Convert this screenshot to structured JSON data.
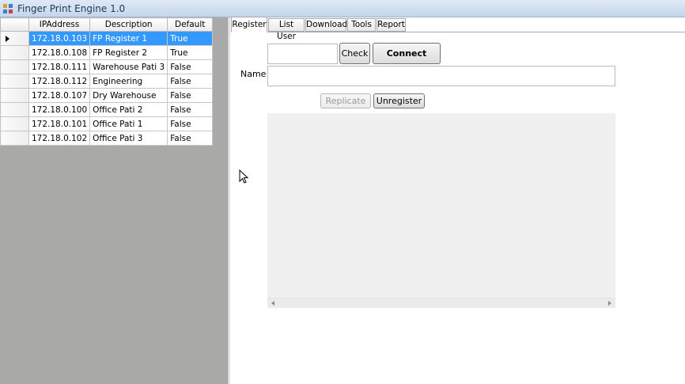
{
  "window": {
    "title": "Finger Print Engine 1.0"
  },
  "grid": {
    "columns": [
      "IPAddress",
      "Description",
      "Default"
    ],
    "selected_row": 0,
    "rows": [
      {
        "ip": "172.18.0.103",
        "description": "FP Register 1",
        "default": "True"
      },
      {
        "ip": "172.18.0.108",
        "description": "FP Register 2",
        "default": "True"
      },
      {
        "ip": "172.18.0.111",
        "description": "Warehouse Pati 3",
        "default": "False"
      },
      {
        "ip": "172.18.0.112",
        "description": "Engineering",
        "default": "False"
      },
      {
        "ip": "172.18.0.107",
        "description": "Dry Warehouse",
        "default": "False"
      },
      {
        "ip": "172.18.0.100",
        "description": "Office Pati 2",
        "default": "False"
      },
      {
        "ip": "172.18.0.101",
        "description": "Office Pati 1",
        "default": "False"
      },
      {
        "ip": "172.18.0.102",
        "description": "Office Pati 3",
        "default": "False"
      }
    ]
  },
  "tabs": [
    {
      "label": "Register",
      "active": true
    },
    {
      "label": "List User",
      "active": false
    },
    {
      "label": "Download",
      "active": false
    },
    {
      "label": "Tools",
      "active": false
    },
    {
      "label": "Report",
      "active": false
    }
  ],
  "register": {
    "id_value": "",
    "check_label": "Check",
    "connect_label": "Connect",
    "name_label": "Name",
    "name_value": "",
    "replicate_label": "Replicate",
    "unregister_label": "Unregister"
  },
  "colors": {
    "selection": "#3399ff",
    "left_panel_bg": "#a9aaa8"
  }
}
